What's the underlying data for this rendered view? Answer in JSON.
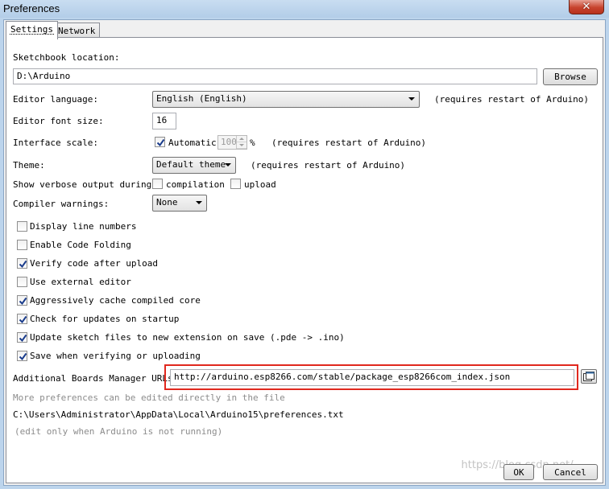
{
  "window": {
    "title": "Preferences",
    "close_glyph": "✕"
  },
  "tabs": [
    {
      "label": "Settings",
      "active": true
    },
    {
      "label": "Network",
      "active": false
    }
  ],
  "sketchbook": {
    "label": "Sketchbook location:",
    "value": "D:\\Arduino",
    "browse_label": "Browse"
  },
  "editor_language": {
    "label": "Editor language:",
    "value": "English (English)",
    "note": "(requires restart of Arduino)"
  },
  "editor_font_size": {
    "label": "Editor font size:",
    "value": "16"
  },
  "interface_scale": {
    "label": "Interface scale:",
    "automatic_label": "Automatic",
    "automatic_checked": true,
    "value": "100",
    "unit": "%",
    "note": "(requires restart of Arduino)"
  },
  "theme": {
    "label": "Theme:",
    "value": "Default theme",
    "note": "(requires restart of Arduino)"
  },
  "verbose": {
    "label": "Show verbose output during:",
    "compilation_label": "compilation",
    "compilation_checked": false,
    "upload_label": "upload",
    "upload_checked": false
  },
  "compiler_warnings": {
    "label": "Compiler warnings:",
    "value": "None"
  },
  "options": [
    {
      "label": "Display line numbers",
      "checked": false
    },
    {
      "label": "Enable Code Folding",
      "checked": false
    },
    {
      "label": "Verify code after upload",
      "checked": true
    },
    {
      "label": "Use external editor",
      "checked": false
    },
    {
      "label": "Aggressively cache compiled core",
      "checked": true
    },
    {
      "label": "Check for updates on startup",
      "checked": true
    },
    {
      "label": "Update sketch files to new extension on save (.pde -> .ino)",
      "checked": true
    },
    {
      "label": "Save when verifying or uploading",
      "checked": true
    }
  ],
  "boards_manager": {
    "label": "Additional Boards Manager URLs:",
    "value": "http://arduino.esp8266.com/stable/package_esp8266com_index.json",
    "highlight_color": "#e0281e"
  },
  "footer": {
    "more_prefs": "More preferences can be edited directly in the file",
    "path": "C:\\Users\\Administrator\\AppData\\Local\\Arduino15\\preferences.txt",
    "edit_note": "(edit only when Arduino is not running)"
  },
  "buttons": {
    "ok": "OK",
    "cancel": "Cancel"
  },
  "watermark": "https://blog.csdn.net/..."
}
